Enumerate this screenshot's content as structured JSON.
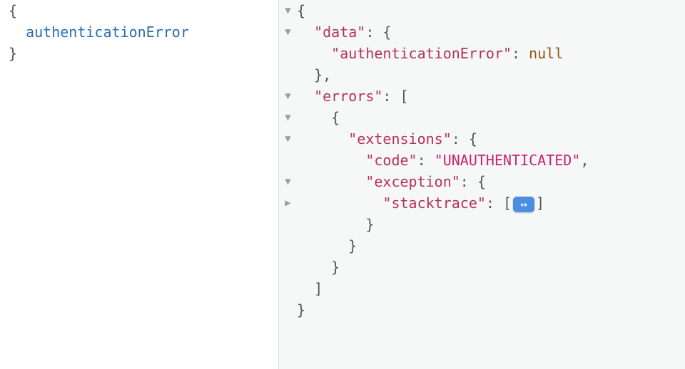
{
  "left": {
    "line1": "{",
    "field": "authenticationError",
    "line3": "}"
  },
  "right": {
    "l1": "{",
    "l2_key": "\"data\"",
    "l2_rest": ": {",
    "l3_key": "\"authenticationError\"",
    "l3_mid": ": ",
    "l3_val": "null",
    "l4": "  },",
    "l5_key": "\"errors\"",
    "l5_rest": ": [",
    "l6": "    {",
    "l7_key": "\"extensions\"",
    "l7_rest": ": {",
    "l8_key": "\"code\"",
    "l8_mid": ": ",
    "l8_val": "\"UNAUTHENTICATED\"",
    "l8_end": ",",
    "l9_key": "\"exception\"",
    "l9_rest": ": {",
    "l10_key": "\"stacktrace\"",
    "l10_mid": ": [",
    "l10_fold": "↔",
    "l10_end": "]",
    "l11": "        }",
    "l12": "      }",
    "l13": "    }",
    "l14": "  ]",
    "l15": "}"
  }
}
